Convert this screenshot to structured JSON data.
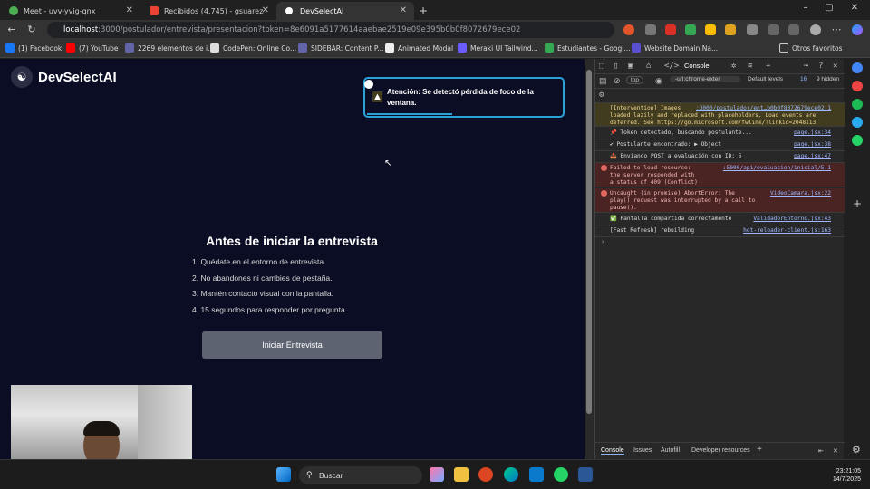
{
  "browser": {
    "tabs": [
      {
        "title": "Meet - uvv-yvig-qnx",
        "active": false
      },
      {
        "title": "Recibidos (4.745) - gsuareza3@u",
        "active": false
      },
      {
        "title": "DevSelectAI",
        "active": true
      }
    ],
    "url_host": "localhost",
    "url_rest": ":3000/postulador/entrevista/presentacion?token=8e6091a5177614aaebae2519e09e395b0b0f8072679ece02",
    "bookmarks": [
      "(1) Facebook",
      "(7) YouTube",
      "2269 elementos de i...",
      "CodePen: Online Co...",
      "SIDEBAR: Content P...",
      "Animated Modal",
      "Meraki UI Tailwind...",
      "Estudiantes - Googl...",
      "Website Domain Na...",
      "Otros favoritos"
    ]
  },
  "page": {
    "brand": "DevSelectAI",
    "toast_message": "Atención: Se detectó pérdida de foco de la ventana.",
    "title": "Antes de iniciar la entrevista",
    "rules": [
      "1. Quédate en el entorno de entrevista.",
      "2. No abandones ni cambies de pestaña.",
      "3. Mantén contacto visual con la pantalla.",
      "4. 15 segundos para responder por pregunta."
    ],
    "start_button": "Iniciar Entrevista"
  },
  "devtools": {
    "active_tab": "Console",
    "context": "top",
    "filter": "-url:chrome-exter",
    "levels": "Default levels",
    "issues_count": "16",
    "hidden": "9 hidden",
    "messages": [
      {
        "level": "warn",
        "text": "[Intervention] Images\nloaded lazily and replaced with placeholders. Load events are\ndeferred. See https://go.microsoft.com/fwlink/?linkid=2048113",
        "src": ":3000/postulador/ent…b0b0f8072679ece02:1"
      },
      {
        "level": "info",
        "text": "📌 Token detectado, buscando postulante...",
        "src": "page.jsx:34"
      },
      {
        "level": "info",
        "text": "✔ Postulante encontrado: ▶ Object",
        "src": "page.jsx:38"
      },
      {
        "level": "info",
        "text": "📤 Enviando POST a evaluación con ID: 5",
        "src": "page.jsx:47"
      },
      {
        "level": "error",
        "text": "Failed to load resource:\nthe server responded with\na status of 409 (Conflict)",
        "src": ":5000/api/evaluacion/inicial/5:1"
      },
      {
        "level": "error",
        "text": "Uncaught (in promise) AbortError: The\nplay() request was interrupted by a call to\npause().",
        "src": "VideoCamara.jsx:22"
      },
      {
        "level": "info",
        "text": "✅ Pantalla compartida correctamente",
        "src": "ValidadorEntorno.jsx:43"
      },
      {
        "level": "info",
        "text": "[Fast Refresh] rebuilding",
        "src": "hot-reloader-client.js:163"
      }
    ],
    "drawer_tabs": [
      "Console",
      "Issues",
      "Autofill",
      "Developer resources"
    ]
  },
  "taskbar": {
    "search_placeholder": "Buscar",
    "time": "23:21:05",
    "date": "14/7/2025"
  }
}
